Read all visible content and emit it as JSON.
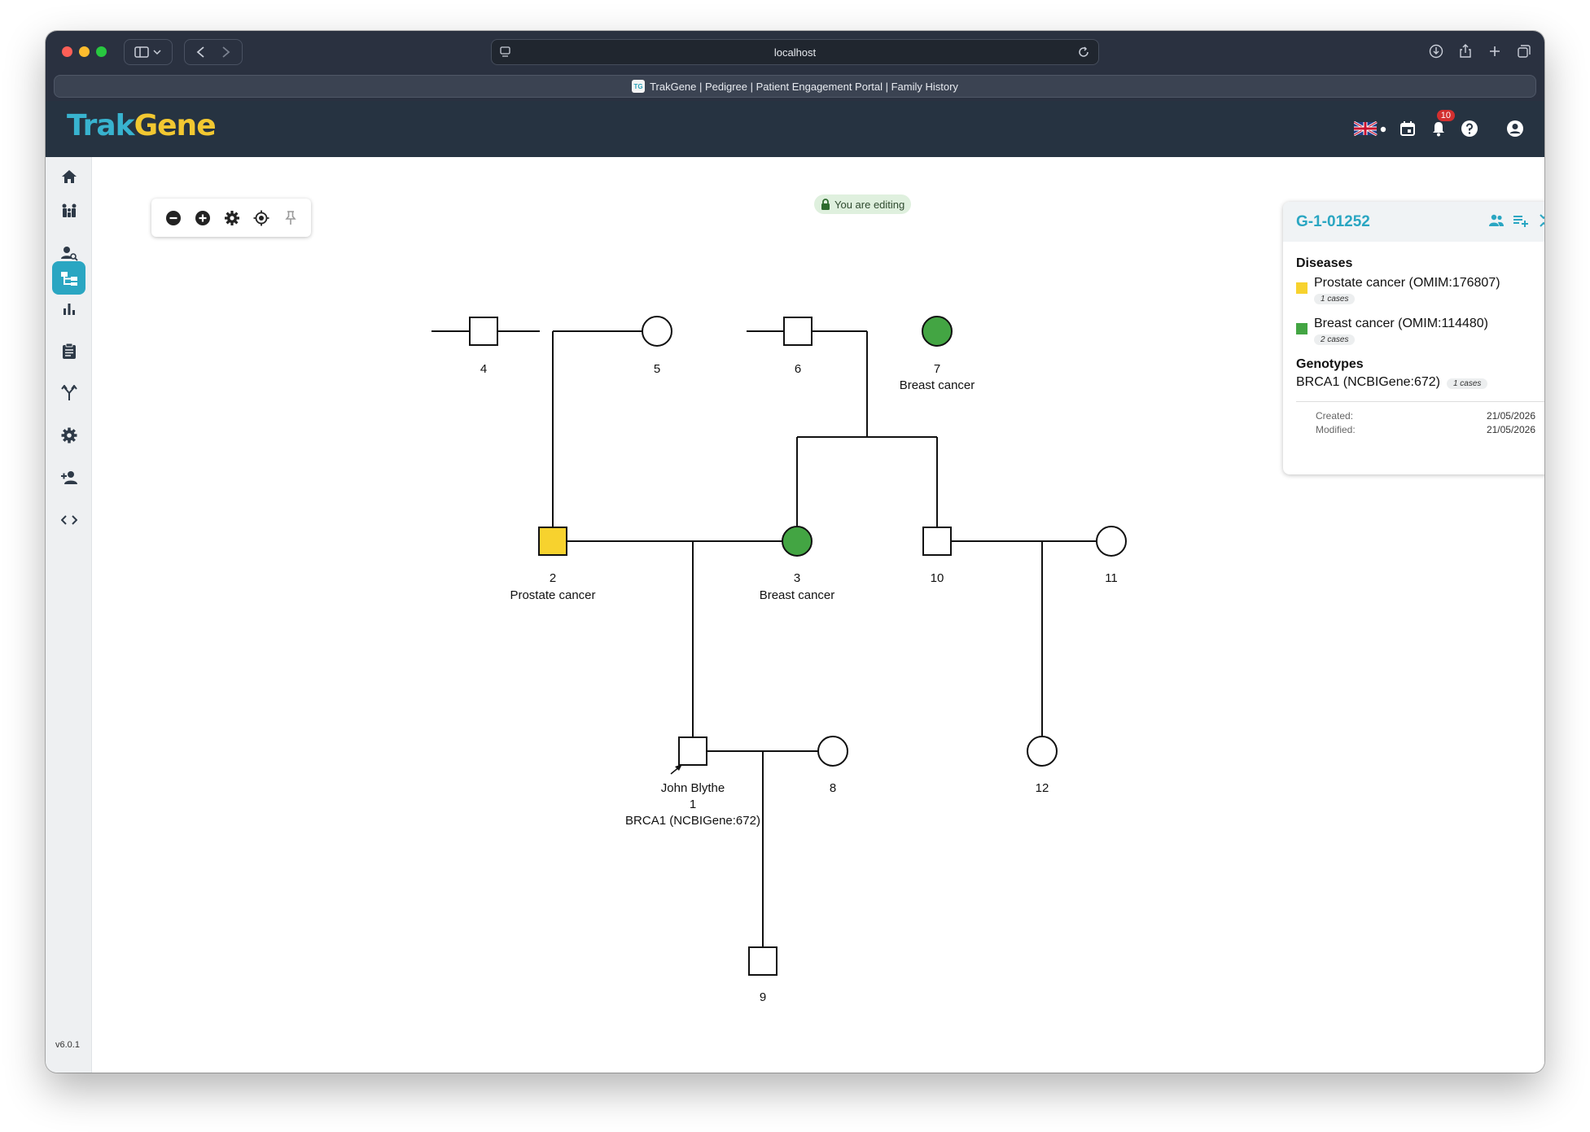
{
  "browser": {
    "url": "localhost",
    "tab_title": "TrakGene | Pedigree | Patient Engagement Portal | Family History",
    "favicon_text": "TG"
  },
  "header": {
    "logo_part1": "Trak",
    "logo_part2": "Gene",
    "notification_count": "10",
    "language": "English (UK)"
  },
  "sidebar": {
    "items": [
      {
        "name": "home-icon"
      },
      {
        "name": "family-icon"
      },
      {
        "name": "person-search-icon"
      },
      {
        "name": "pedigree-icon",
        "active": true
      },
      {
        "name": "bar-chart-icon"
      },
      {
        "name": "clipboard-icon"
      },
      {
        "name": "fork-icon"
      },
      {
        "name": "gear-icon"
      },
      {
        "name": "add-person-icon"
      },
      {
        "name": "code-icon"
      }
    ],
    "version": "v6.0.1"
  },
  "editing_badge": "You are editing",
  "pedigree": {
    "individuals": [
      {
        "id": "4",
        "sex": "male",
        "label": "4",
        "disease": null
      },
      {
        "id": "5",
        "sex": "female",
        "label": "5",
        "disease": null
      },
      {
        "id": "6",
        "sex": "male",
        "label": "6",
        "disease": null
      },
      {
        "id": "7",
        "sex": "female",
        "label": "7",
        "disease": "Breast cancer",
        "color": "#43a543"
      },
      {
        "id": "2",
        "sex": "male",
        "label": "2",
        "disease": "Prostate cancer",
        "color": "#f7d22e"
      },
      {
        "id": "3",
        "sex": "female",
        "label": "3",
        "disease": "Breast cancer",
        "color": "#43a543"
      },
      {
        "id": "10",
        "sex": "male",
        "label": "10",
        "disease": null
      },
      {
        "id": "11",
        "sex": "female",
        "label": "11",
        "disease": null
      },
      {
        "id": "1",
        "sex": "male",
        "label": "1",
        "name": "John Blythe",
        "genotype": "BRCA1 (NCBIGene:672)",
        "proband": true
      },
      {
        "id": "8",
        "sex": "female",
        "label": "8",
        "disease": null
      },
      {
        "id": "12",
        "sex": "female",
        "label": "12",
        "disease": null
      },
      {
        "id": "9",
        "sex": "male",
        "label": "9",
        "disease": null
      }
    ]
  },
  "panel": {
    "family_id": "G-1-01252",
    "diseases_title": "Diseases",
    "diseases": [
      {
        "name": "Prostate cancer (OMIM:176807)",
        "cases": "1 cases",
        "color": "#f7d22e"
      },
      {
        "name": "Breast cancer (OMIM:114480)",
        "cases": "2 cases",
        "color": "#43a543"
      }
    ],
    "genotypes_title": "Genotypes",
    "genotypes": [
      {
        "name": "BRCA1 (NCBIGene:672)",
        "cases": "1 cases"
      }
    ],
    "created_label": "Created:",
    "created_value": "21/05/2026",
    "modified_label": "Modified:",
    "modified_value": "21/05/2026"
  }
}
